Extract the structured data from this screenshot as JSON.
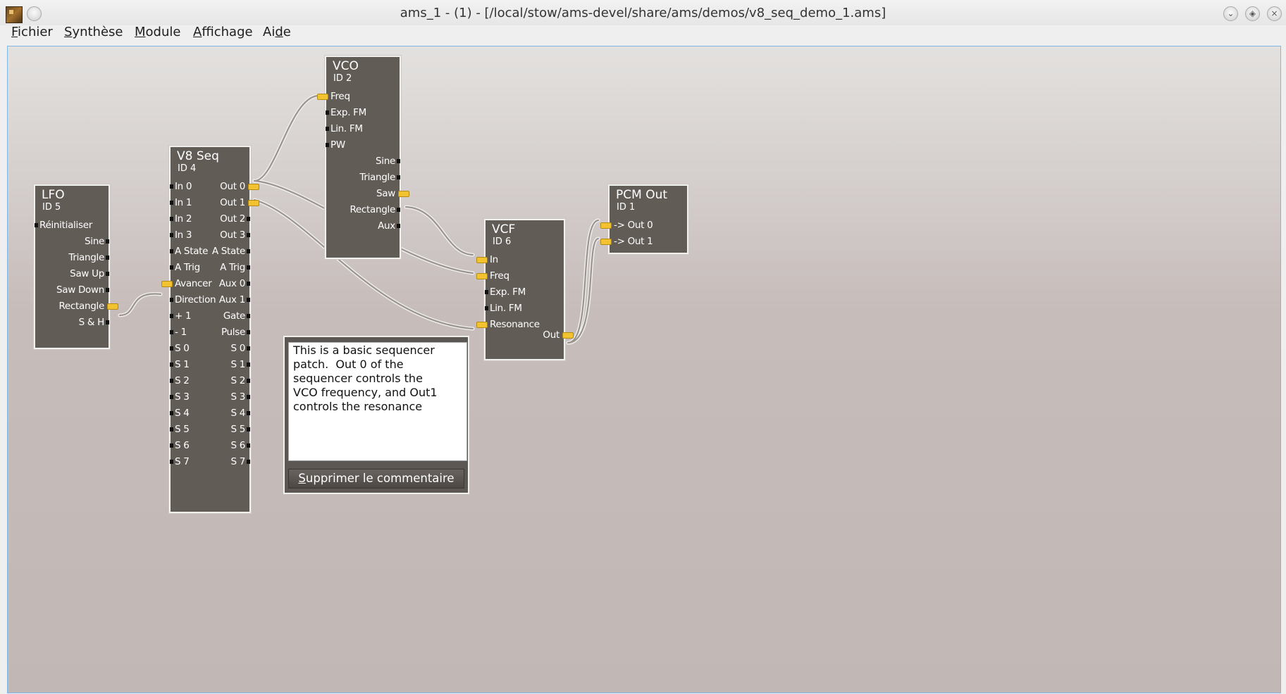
{
  "window": {
    "title": "ams_1 - (1) - [/local/stow/ams-devel/share/ams/demos/v8_seq_demo_1.ams]"
  },
  "menu": {
    "items": [
      {
        "mnemonic": "F",
        "rest": "ichier"
      },
      {
        "mnemonic": "S",
        "rest": "ynthèse"
      },
      {
        "mnemonic": "M",
        "rest": "odule"
      },
      {
        "mnemonic": "A",
        "rest": "ffichage"
      },
      {
        "pre": "Ai",
        "mnemonic": "d",
        "rest": "e"
      }
    ]
  },
  "modules": {
    "lfo": {
      "name": "LFO",
      "id": "ID 5",
      "inputs": [
        "Réinitialiser"
      ],
      "outputs": [
        "Sine",
        "Triangle",
        "Saw Up",
        "Saw Down",
        "Rectangle",
        "S & H"
      ]
    },
    "v8seq": {
      "name": "V8 Seq",
      "id": "ID 4",
      "inputs": [
        "In 0",
        "In 1",
        "In 2",
        "In 3",
        "A State",
        "A Trig",
        "Avancer",
        "Direction",
        "+ 1",
        "- 1",
        "S 0",
        "S 1",
        "S 2",
        "S 3",
        "S 4",
        "S 5",
        "S 6",
        "S 7"
      ],
      "outputs": [
        "Out 0",
        "Out 1",
        "Out 2",
        "Out 3",
        "A State",
        "A Trig",
        "Aux 0",
        "Aux 1",
        "Gate",
        "Pulse",
        "S 0",
        "S 1",
        "S 2",
        "S 3",
        "S 4",
        "S 5",
        "S 6",
        "S 7"
      ]
    },
    "vco": {
      "name": "VCO",
      "id": "ID 2",
      "inputs": [
        "Freq",
        "Exp. FM",
        "Lin. FM",
        "PW"
      ],
      "outputs": [
        "Sine",
        "Triangle",
        "Saw",
        "Rectangle",
        "Aux"
      ]
    },
    "vcf": {
      "name": "VCF",
      "id": "ID 6",
      "inputs": [
        "In",
        "Freq",
        "Exp. FM",
        "Lin. FM",
        "Resonance"
      ],
      "outputs": [
        "Out"
      ]
    },
    "pcmout": {
      "name": "PCM Out",
      "id": "ID 1",
      "inputs": [
        "-> Out  0",
        "-> Out  1"
      ],
      "outputs": []
    }
  },
  "comment": {
    "text": "This is a basic sequencer\npatch.  Out 0 of the\nsequencer controls the\nVCO frequency, and Out1\ncontrols the resonance",
    "delete_mnemonic": "S",
    "delete_rest": "upprimer le commentaire"
  },
  "colors": {
    "module_bg": "#625c57",
    "plug": "#f2c230",
    "wire": "#9a9490"
  }
}
